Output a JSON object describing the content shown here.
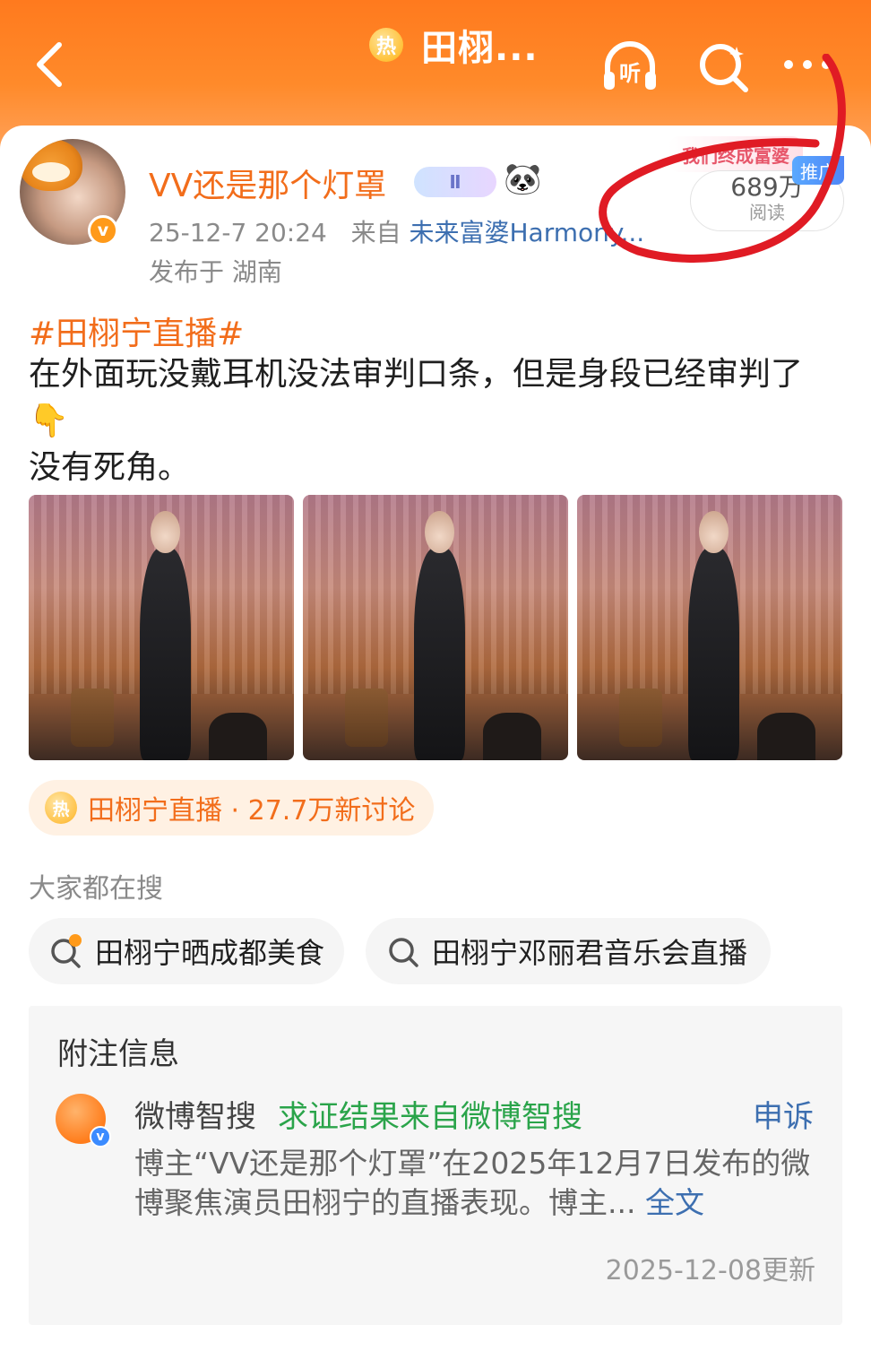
{
  "topbar": {
    "hot_badge": "热",
    "title": "田栩...",
    "listen_label": "听"
  },
  "post": {
    "username": "VV还是那个灯罩",
    "level_badge": "Ⅱ",
    "emoji_badge": "🐼",
    "timestamp": "25-12-7 20:24",
    "from_label": "来自",
    "source": "未来富婆Harmony...",
    "location": "发布于 湖南",
    "reads_count": "689万",
    "reads_label": "阅读",
    "promo_badge": "我们终成富婆",
    "promote_tag": "推广",
    "hashtag": "#田栩宁直播#",
    "line1": "在外面玩没戴耳机没法审判口条，但是身段已经审判了👇",
    "line2": "没有死角。"
  },
  "topic": {
    "icon": "热",
    "text": "田栩宁直播 · 27.7万新讨论"
  },
  "searches": {
    "title": "大家都在搜",
    "items": [
      {
        "label": "田栩宁晒成都美食",
        "icon": "hot-search-icon"
      },
      {
        "label": "田栩宁邓丽君音乐会直播",
        "icon": "search-icon"
      }
    ]
  },
  "note": {
    "title": "附注信息",
    "source_name": "微博智搜",
    "result": "求证结果来自微博智搜",
    "appeal": "申诉",
    "text": "博主“VV还是那个灯罩”在2025年12月7日发布的微博聚焦演员田栩宁的直播表现。博主...",
    "full_link": "全文",
    "updated": "2025-12-08更新"
  },
  "colors": {
    "brand_orange": "#ff7a1e",
    "username": "#f26d1b",
    "link_blue": "#3d6fb0",
    "verified_green": "#2aa44a",
    "annotation_red": "#e01b24"
  }
}
